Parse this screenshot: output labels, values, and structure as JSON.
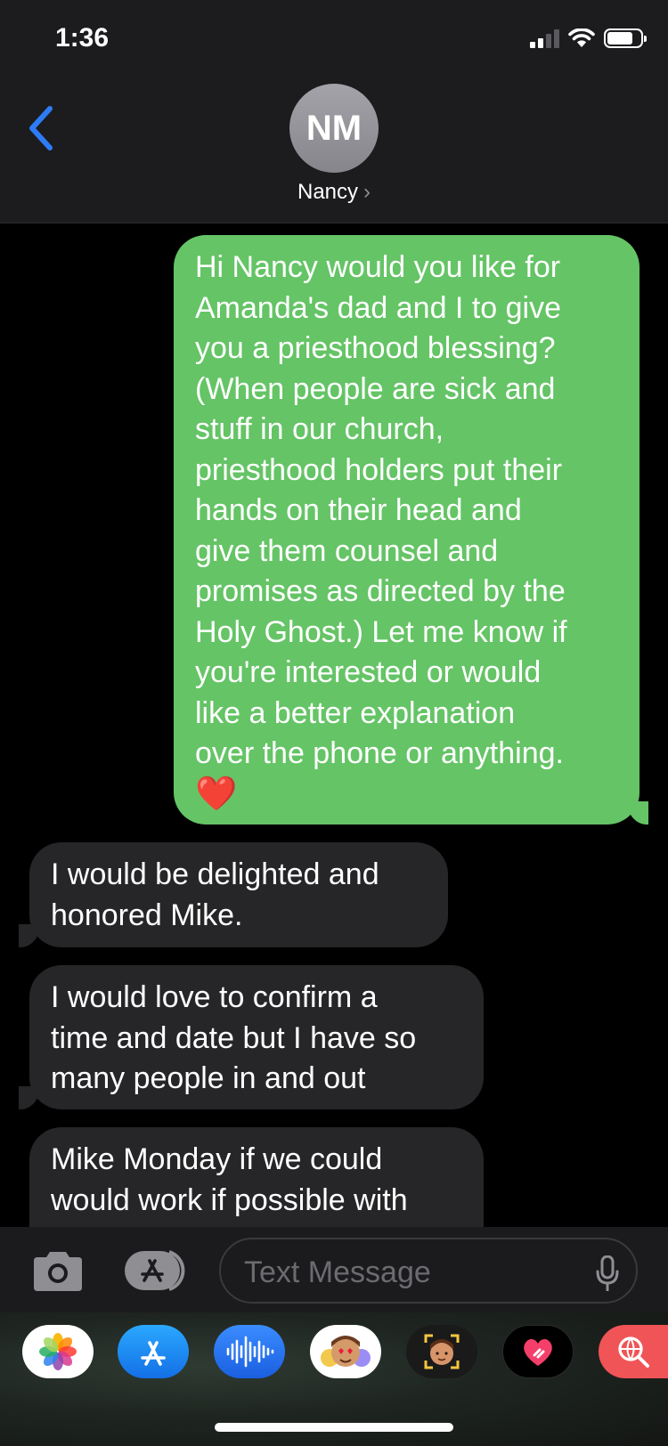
{
  "status_bar": {
    "time": "1:36"
  },
  "header": {
    "avatar_initials": "NM",
    "contact_name": "Nancy",
    "contact_chevron": "›"
  },
  "messages": [
    {
      "direction": "outgoing",
      "lines": [
        "Hi Nancy would you like for",
        "Amanda's dad and I to give",
        "you a priesthood blessing?",
        "(When people are sick and",
        "stuff in our church,",
        "priesthood holders put their",
        "hands on their head and",
        "give them counsel and",
        "promises as directed by the",
        "Holy Ghost.) Let me know if",
        "you're interested or would",
        "like a better explanation",
        "over the phone or anything."
      ],
      "emoji": "❤️"
    },
    {
      "direction": "incoming",
      "lines": [
        "I would be delighted and",
        "honored Mike."
      ]
    },
    {
      "direction": "incoming",
      "lines": [
        "I would love to confirm a",
        "time and date but I have so",
        "many people in and out"
      ]
    },
    {
      "direction": "incoming",
      "lines": [
        "Mike Monday if we could",
        "would work if possible with"
      ]
    }
  ],
  "input_bar": {
    "placeholder": "Text Message"
  },
  "app_drawer": [
    {
      "name": "photos-app-icon",
      "bg": "#ffffff"
    },
    {
      "name": "app-store-app-icon",
      "bg": "#1a8cff"
    },
    {
      "name": "audio-message-app-icon",
      "bg": "#1a73f0"
    },
    {
      "name": "memoji-stickers-app-icon",
      "bg": "#ffffff"
    },
    {
      "name": "memoji-app-icon",
      "bg": "#1a1a1a"
    },
    {
      "name": "digital-touch-app-icon",
      "bg": "#000000"
    },
    {
      "name": "images-search-app-icon",
      "bg": "#f05456"
    }
  ],
  "colors": {
    "outgoing_bubble": "#65c466",
    "incoming_bubble": "#262628",
    "accent_blue": "#2d7cf6",
    "header_bg": "#1c1c1e"
  }
}
